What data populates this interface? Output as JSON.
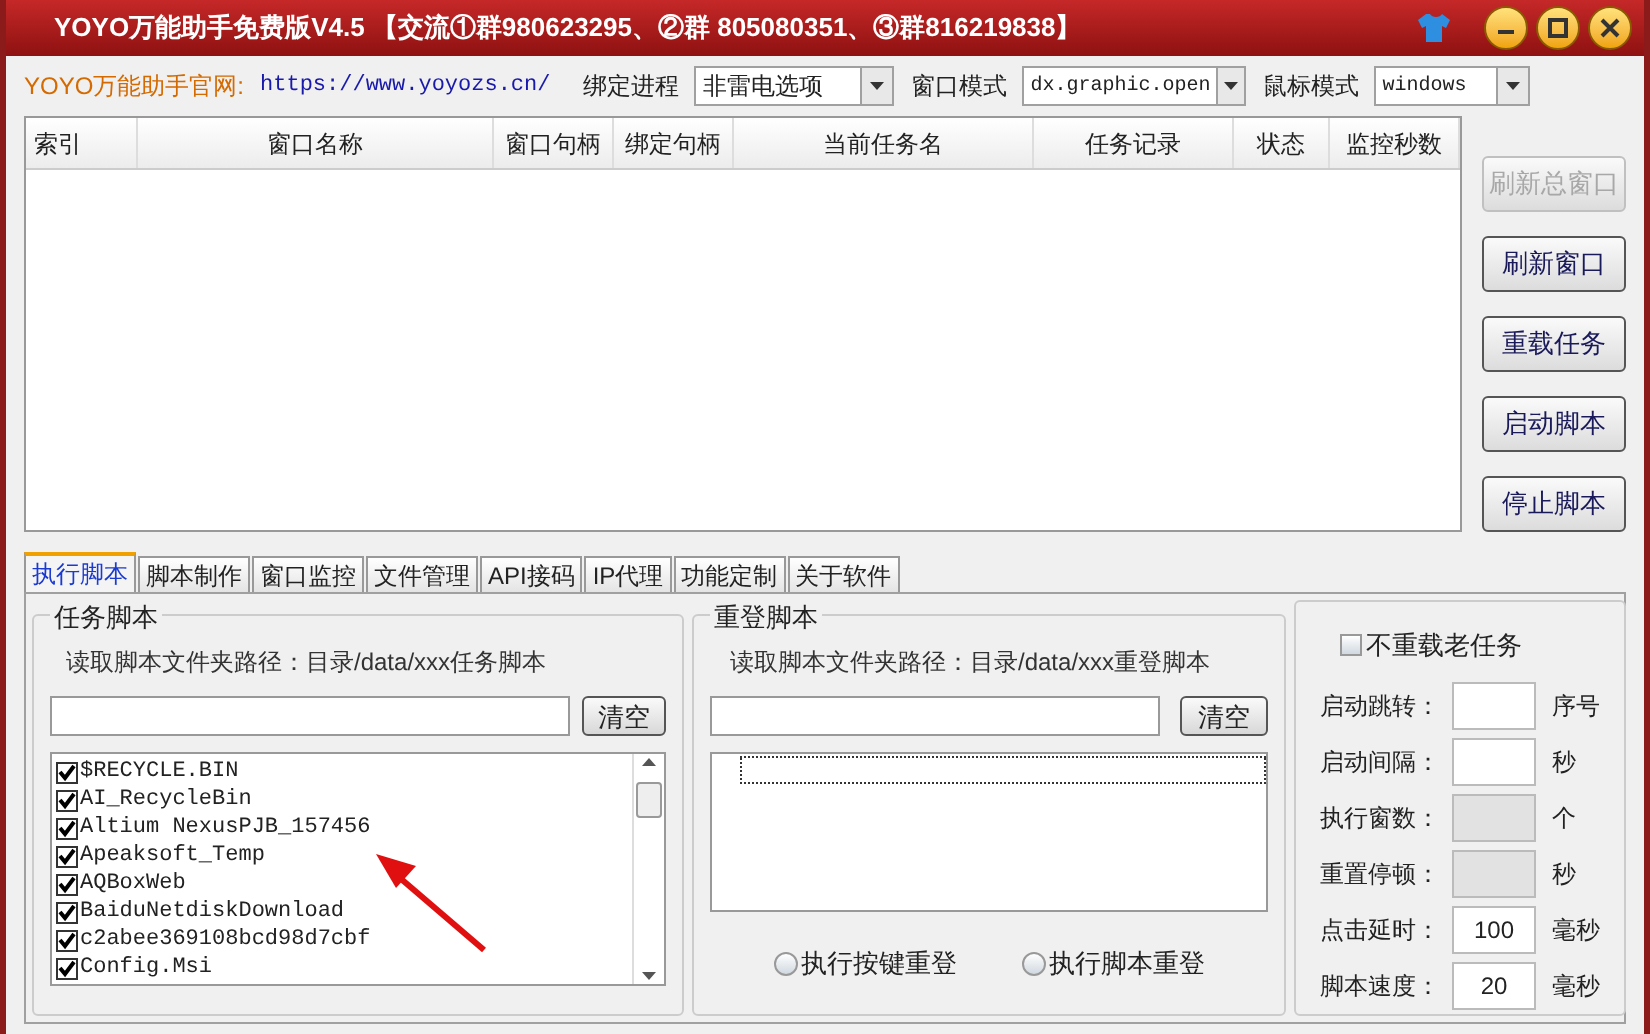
{
  "window": {
    "title": "YOYO万能助手免费版V4.5 【交流①群980623295、②群 805080351、③群816219838】"
  },
  "toolbar": {
    "site_label": "YOYO万能助手官网:",
    "site_url": "https://www.yoyozs.cn/",
    "combos": [
      {
        "label": "绑定进程",
        "value": "非雷电选项"
      },
      {
        "label": "窗口模式",
        "value": "dx.graphic.open"
      },
      {
        "label": "鼠标模式",
        "value": "windows"
      }
    ]
  },
  "table": {
    "columns": [
      "索引",
      "窗口名称",
      "窗口句柄",
      "绑定句柄",
      "当前任务名",
      "任务记录",
      "状态",
      "监控秒数"
    ]
  },
  "side_buttons": [
    {
      "label": "刷新总窗口",
      "disabled": true
    },
    {
      "label": "刷新窗口",
      "disabled": false
    },
    {
      "label": "重载任务",
      "disabled": false
    },
    {
      "label": "启动脚本",
      "disabled": false
    },
    {
      "label": "停止脚本",
      "disabled": false
    }
  ],
  "tabs": [
    {
      "label": "执行脚本",
      "selected": true
    },
    {
      "label": "脚本制作",
      "selected": false
    },
    {
      "label": "窗口监控",
      "selected": false
    },
    {
      "label": "文件管理",
      "selected": false
    },
    {
      "label": "API接码",
      "selected": false
    },
    {
      "label": "IP代理",
      "selected": false
    },
    {
      "label": "功能定制",
      "selected": false
    },
    {
      "label": "关于软件",
      "selected": false
    }
  ],
  "task_scripts": {
    "title": "任务脚本",
    "path": "读取脚本文件夹路径：目录/data/xxx任务脚本",
    "clear_button": "清空",
    "items": [
      {
        "name": "$RECYCLE.BIN",
        "checked": true
      },
      {
        "name": "AI_RecycleBin",
        "checked": true
      },
      {
        "name": "Altium NexusPJB_157456",
        "checked": true
      },
      {
        "name": "Apeaksoft_Temp",
        "checked": true
      },
      {
        "name": "AQBoxWeb",
        "checked": true
      },
      {
        "name": "BaiduNetdiskDownload",
        "checked": true
      },
      {
        "name": "c2abee369108bcd98d7cbf",
        "checked": true
      },
      {
        "name": "Config.Msi",
        "checked": true
      }
    ]
  },
  "relogin_scripts": {
    "title": "重登脚本",
    "path": "读取脚本文件夹路径：目录/data/xxx重登脚本",
    "clear_button": "清空",
    "radios": [
      {
        "label": "执行按键重登",
        "selected": false
      },
      {
        "label": "执行脚本重登",
        "selected": false
      }
    ]
  },
  "settings": {
    "no_reload": {
      "label": "不重载老任务",
      "checked": false
    },
    "fields": [
      {
        "label": "启动跳转：",
        "unit": "序号",
        "disabled": false
      },
      {
        "label": "启动间隔：",
        "unit": "秒",
        "disabled": false
      },
      {
        "label": "执行窗数：",
        "unit": "个",
        "disabled": true
      },
      {
        "label": "重置停顿：",
        "unit": "秒",
        "disabled": true
      },
      {
        "label": "点击延时：",
        "value": "100",
        "unit": "毫秒",
        "disabled": false
      },
      {
        "label": "脚本速度：",
        "value": "20",
        "unit": "毫秒",
        "disabled": false
      }
    ]
  }
}
